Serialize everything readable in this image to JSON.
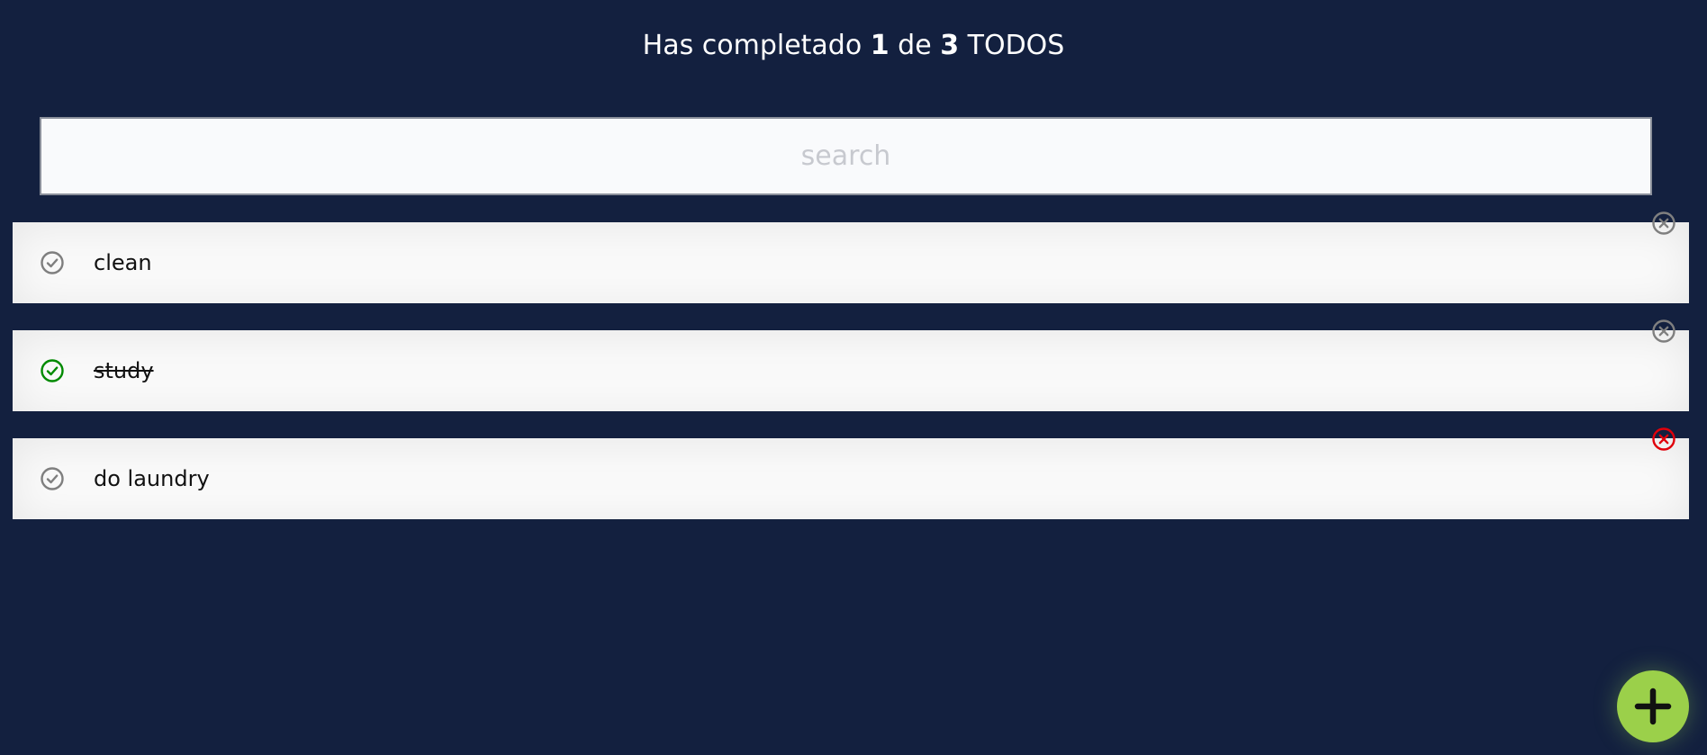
{
  "header": {
    "prefix": "Has completado",
    "completed": "1",
    "middle": "de",
    "total": "3",
    "suffix": "TODOS"
  },
  "search": {
    "placeholder": "search",
    "value": ""
  },
  "todos": [
    {
      "text": "clean",
      "completed": false,
      "delete_color": "#7f7f7f"
    },
    {
      "text": "study",
      "completed": true,
      "delete_color": "#7f7f7f"
    },
    {
      "text": "do laundry",
      "completed": false,
      "delete_color": "#e0000b"
    }
  ],
  "icons": {
    "check": "check-circle-icon",
    "delete": "close-circle-icon",
    "add": "plus-icon"
  },
  "colors": {
    "background": "#13203f",
    "check_default": "#7f7f7f",
    "check_done": "#008a00",
    "fab": "#9bd04a"
  }
}
